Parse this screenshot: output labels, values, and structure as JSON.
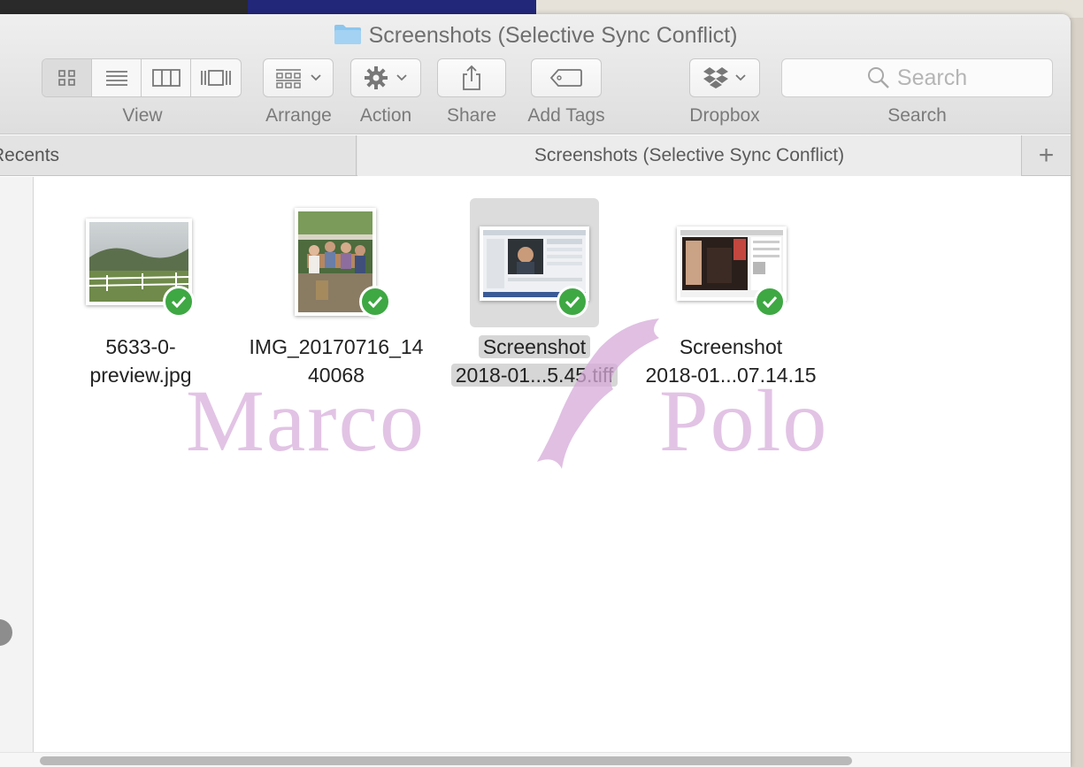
{
  "window": {
    "title": "Screenshots (Selective Sync Conflict)"
  },
  "toolbar": {
    "view_label": "View",
    "arrange_label": "Arrange",
    "action_label": "Action",
    "share_label": "Share",
    "add_tags_label": "Add Tags",
    "dropbox_label": "Dropbox",
    "search_label": "Search",
    "search_placeholder": "Search"
  },
  "tabs": {
    "left_tab": "Recents",
    "active_tab": "Screenshots (Selective Sync Conflict)",
    "add_symbol": "+"
  },
  "files": [
    {
      "line1": "5633-0-",
      "line2": "preview.jpg",
      "synced": true,
      "selected": false
    },
    {
      "line1": "IMG_20170716_14",
      "line2": "40068",
      "synced": true,
      "selected": false
    },
    {
      "line1": "Screenshot",
      "line2": "2018-01...5.45.tiff",
      "synced": true,
      "selected": true
    },
    {
      "line1": "Screenshot",
      "line2": "2018-01...07.14.15",
      "synced": true,
      "selected": false
    }
  ],
  "watermark": {
    "left": "Marco",
    "right": "Polo"
  },
  "colors": {
    "sync_check": "#3ea843",
    "watermark": "#d6aada",
    "folder": "#8cc6ee"
  }
}
